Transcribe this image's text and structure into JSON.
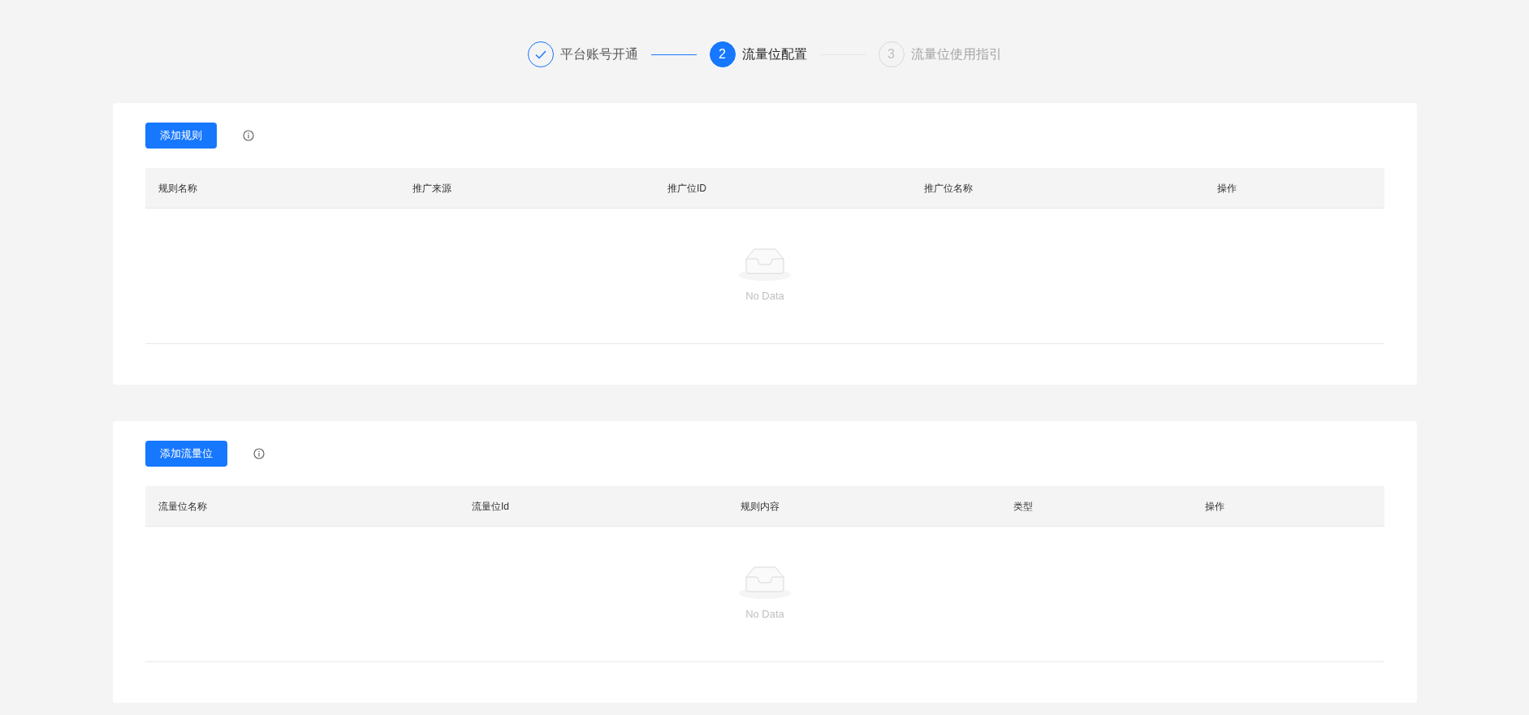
{
  "steps": [
    {
      "title": "平台账号开通",
      "completed": true,
      "current": false
    },
    {
      "marker": "2",
      "title": "流量位配置",
      "completed": false,
      "current": true
    },
    {
      "marker": "3",
      "title": "流量位使用指引",
      "completed": false,
      "current": false
    }
  ],
  "panels": [
    {
      "button": "添加规则",
      "columns": [
        "规则名称",
        "推广来源",
        "推广位ID",
        "推广位名称",
        "操作"
      ],
      "empty_text": "No Data"
    },
    {
      "button": "添加流量位",
      "columns": [
        "流量位名称",
        "流量位Id",
        "规则内容",
        "类型",
        "操作"
      ],
      "empty_text": "No Data"
    }
  ]
}
